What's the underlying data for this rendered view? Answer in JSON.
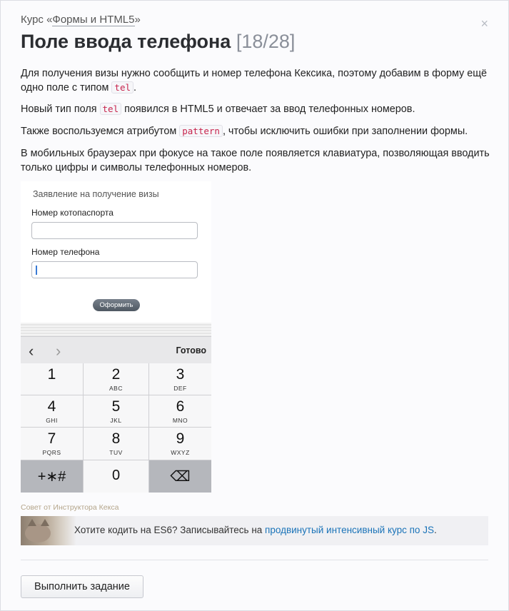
{
  "header": {
    "course_prefix": "Курс «",
    "course_link": "Формы и HTML5",
    "course_suffix": "»",
    "close_glyph": "×",
    "title": "Поле ввода телефона",
    "counter": "[18/28]"
  },
  "paragraphs": {
    "p1_a": "Для получения визы нужно сообщить и номер телефона Кексика, поэтому добавим в форму ещё одно поле с типом ",
    "p1_code": "tel",
    "p1_b": ".",
    "p2_a": "Новый тип поля ",
    "p2_code": "tel",
    "p2_b": " появился в HTML5 и отвечает за ввод телефонных номеров.",
    "p3_a": "Также воспользуемся атрибутом ",
    "p3_code": "pattern",
    "p3_b": ", чтобы исключить ошибки при заполнении формы.",
    "p4": "В мобильных браузерах при фокусе на такое поле появляется клавиатура, позволяющая вводить только цифры и символы телефонных номеров."
  },
  "phone_form": {
    "title": "Заявление на получение визы",
    "field1_label": "Номер котопаспорта",
    "field2_label": "Номер телефона",
    "submit": "Оформить"
  },
  "keyboard": {
    "prev_icon": "‹",
    "next_icon": "›",
    "done": "Готово",
    "keys": [
      {
        "digit": "1",
        "letters": ""
      },
      {
        "digit": "2",
        "letters": "ABC"
      },
      {
        "digit": "3",
        "letters": "DEF"
      },
      {
        "digit": "4",
        "letters": "GHI"
      },
      {
        "digit": "5",
        "letters": "JKL"
      },
      {
        "digit": "6",
        "letters": "MNO"
      },
      {
        "digit": "7",
        "letters": "PQRS"
      },
      {
        "digit": "8",
        "letters": "TUV"
      },
      {
        "digit": "9",
        "letters": "WXYZ"
      }
    ],
    "symbols": "+∗#",
    "zero": "0",
    "backspace_icon": "⌫"
  },
  "tip": {
    "label": "Совет от Инструктора Кекса",
    "text": "Хотите кодить на ES6? Записывайтесь на ",
    "link": "продвинутый интенсивный курс по JS",
    "end": "."
  },
  "action": {
    "button": "Выполнить задание"
  }
}
